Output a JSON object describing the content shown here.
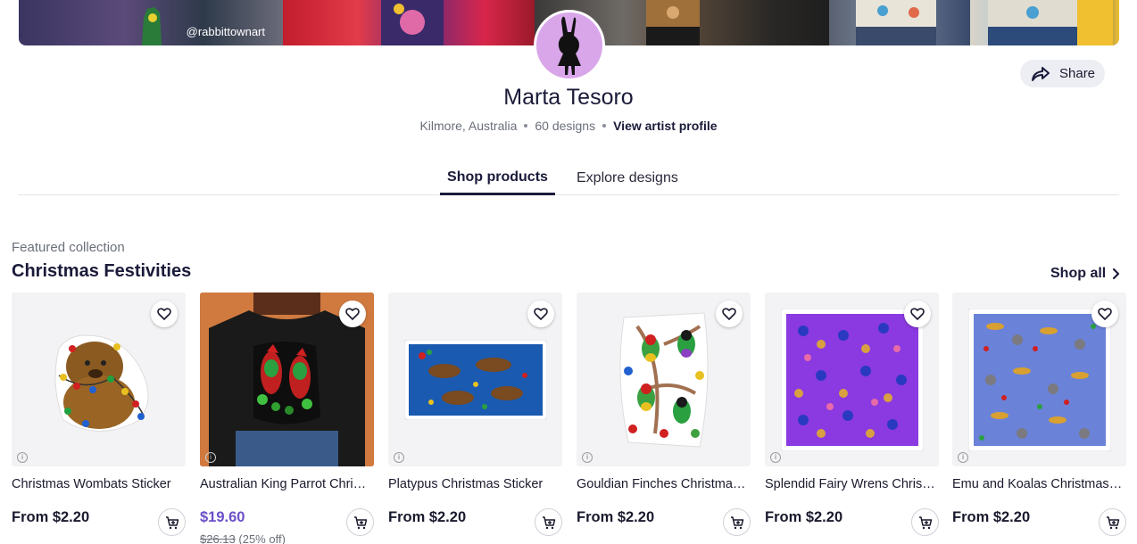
{
  "banner": {
    "handle": "@rabbittownart"
  },
  "share": {
    "label": "Share"
  },
  "artist": {
    "name": "Marta Tesoro",
    "location": "Kilmore, Australia",
    "designs": "60 designs",
    "profile_link": "View artist profile"
  },
  "tabs": [
    {
      "label": "Shop products",
      "active": true
    },
    {
      "label": "Explore designs",
      "active": false
    }
  ],
  "collection": {
    "label": "Featured collection",
    "title": "Christmas Festivities",
    "shop_all": "Shop all"
  },
  "products": [
    {
      "title": "Christmas Wombats Sticker",
      "price": "From $2.20"
    },
    {
      "title": "Australian King Parrot Christmas Classic T-Shirt",
      "price": "$19.60",
      "old_price": "$26.13",
      "discount": "(25% off)"
    },
    {
      "title": "Platypus Christmas Sticker",
      "price": "From $2.20"
    },
    {
      "title": "Gouldian Finches Christmas Sticker",
      "price": "From $2.20"
    },
    {
      "title": "Splendid Fairy Wrens Christmas Sticker",
      "price": "From $2.20"
    },
    {
      "title": "Emu and Koalas Christmas Sticker",
      "price": "From $2.20"
    }
  ],
  "colors": {
    "accent": "#6b4fc8",
    "text": "#1a1a3a",
    "muted": "#6a6f7a",
    "avatar_bg": "#d9a6ea"
  },
  "icons": [
    "share-icon",
    "heart-icon",
    "cart-icon",
    "info-icon",
    "chevron-right-icon"
  ]
}
